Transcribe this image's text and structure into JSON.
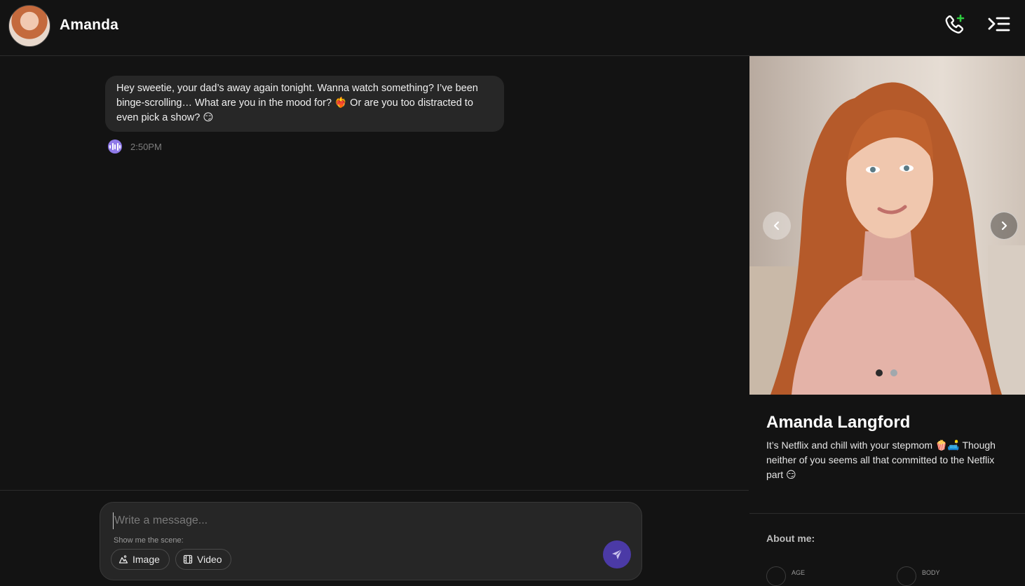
{
  "header": {
    "name": "Amanda",
    "call_icon": "phone-plus-icon",
    "menu_icon": "menu-expand-icon"
  },
  "chat": {
    "messages": [
      {
        "text": "Hey sweetie, your dad’s away again tonight. Wanna watch something? I’ve been binge-scrolling… What are you in the mood for? ❤️‍🔥 Or are you too distracted to even pick a show? 😏",
        "time": "2:50PM",
        "audio_icon": "voice-wave-icon"
      }
    ]
  },
  "composer": {
    "placeholder": "Write a message...",
    "scene_label": "Show me the scene:",
    "image_label": "Image",
    "video_label": "Video",
    "send_icon": "send-icon"
  },
  "profile": {
    "name": "Amanda Langford",
    "description": "It’s Netflix and chill with your stepmom 🍿🛋️ Though neither of you seems all that committed to the Netflix part 😏",
    "about_title": "About me:",
    "carousel": {
      "total": 2,
      "active": 1
    },
    "attributes": [
      {
        "label": "AGE"
      },
      {
        "label": "BODY"
      }
    ]
  },
  "colors": {
    "background": "#131313",
    "bubble": "#272727",
    "accent": "#4b3aa6",
    "voice": "#8f7ae8",
    "call_plus": "#2ecc40"
  }
}
